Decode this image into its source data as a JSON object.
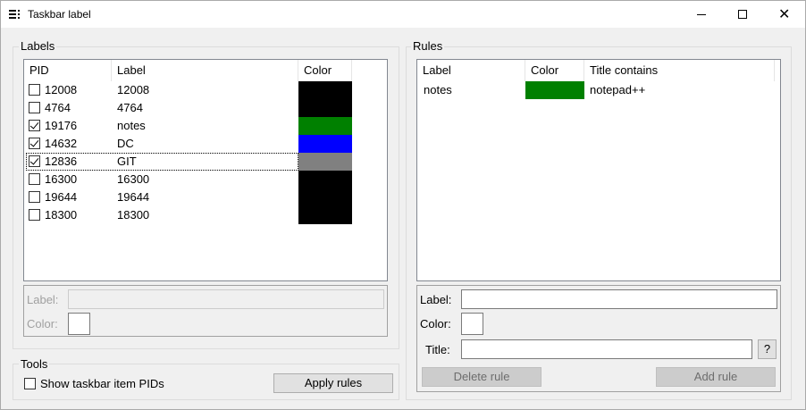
{
  "window": {
    "title": "Taskbar label",
    "controls": {
      "minimize": "minimize-icon",
      "maximize": "maximize-icon",
      "close": "close-icon"
    },
    "close_glyph": "✕"
  },
  "labels_group": {
    "title": "Labels",
    "columns": [
      "PID",
      "Label",
      "Color"
    ],
    "rows": [
      {
        "pid": "12008",
        "label": "12008",
        "checked": false,
        "color": "#000000"
      },
      {
        "pid": "4764",
        "label": "4764",
        "checked": false,
        "color": "#000000"
      },
      {
        "pid": "19176",
        "label": "notes",
        "checked": true,
        "color": "#008000"
      },
      {
        "pid": "14632",
        "label": "DC",
        "checked": true,
        "color": "#0000ff"
      },
      {
        "pid": "12836",
        "label": "GIT",
        "checked": true,
        "color": "#808080"
      },
      {
        "pid": "16300",
        "label": "16300",
        "checked": false,
        "color": "#000000"
      },
      {
        "pid": "19644",
        "label": "19644",
        "checked": false,
        "color": "#000000"
      },
      {
        "pid": "18300",
        "label": "18300",
        "checked": false,
        "color": "#000000"
      }
    ],
    "editor": {
      "label_caption": "Label:",
      "color_caption": "Color:",
      "label_value": ""
    }
  },
  "tools_group": {
    "title": "Tools",
    "show_pids_label": "Show taskbar item PIDs",
    "show_pids_checked": false,
    "apply_button": "Apply rules"
  },
  "rules_group": {
    "title": "Rules",
    "columns": [
      "Label",
      "Color",
      "Title contains"
    ],
    "rows": [
      {
        "label": "notes",
        "color": "#008000",
        "title_contains": "notepad++"
      }
    ],
    "editor": {
      "label_caption": "Label:",
      "color_caption": "Color:",
      "title_caption": "Title:",
      "help_button": "?",
      "delete_button": "Delete rule",
      "add_button": "Add rule"
    }
  }
}
